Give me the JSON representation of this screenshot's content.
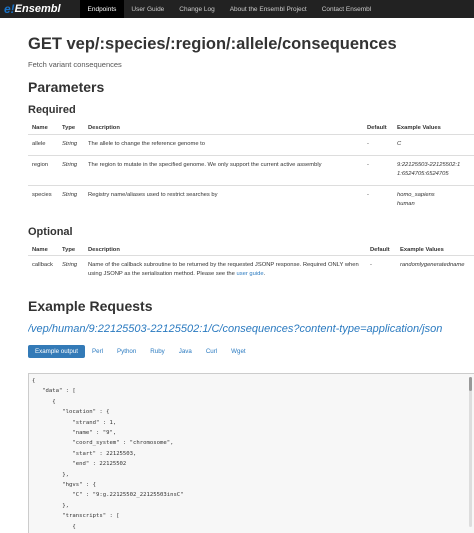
{
  "brand": {
    "e": "e!",
    "name": "Ensembl"
  },
  "nav": [
    "Endpoints",
    "User Guide",
    "Change Log",
    "About the Ensembl Project",
    "Contact Ensembl"
  ],
  "page": {
    "title": "GET vep/:species/:region/:allele/consequences",
    "subtitle": "Fetch variant consequences"
  },
  "parameters_heading": "Parameters",
  "required": {
    "heading": "Required",
    "headers": [
      "Name",
      "Type",
      "Description",
      "Default",
      "Example Values"
    ],
    "rows": [
      {
        "name": "allele",
        "type": "String",
        "desc": "The allele to change the reference genome to",
        "default": "-",
        "ex1": "C",
        "ex2": ""
      },
      {
        "name": "region",
        "type": "String",
        "desc": "The region to mutate in the specified genome. We only support the current active assembly",
        "default": "-",
        "ex1": "9:22125503-22125502:1",
        "ex2": "1:6524705:6524705"
      },
      {
        "name": "species",
        "type": "String",
        "desc": "Registry name/aliases used to restrict searches by",
        "default": "-",
        "ex1": "homo_sapiens",
        "ex2": "human"
      }
    ]
  },
  "optional": {
    "heading": "Optional",
    "headers": [
      "Name",
      "Type",
      "Description",
      "Default",
      "Example Values"
    ],
    "rows": [
      {
        "name": "callback",
        "type": "String",
        "desc": "Name of the callback subroutine to be returned by the requested JSONP response. Required ONLY when using JSONP as the serialisation method. Please see the",
        "link": "user guide",
        "after": ".",
        "default": "-",
        "ex1": "randomlygeneratedname"
      }
    ]
  },
  "example": {
    "heading": "Example Requests",
    "url": "/vep/human/9:22125503-22125502:1/C/consequences?content-type=application/json",
    "tabs": [
      "Example output",
      "Perl",
      "Python",
      "Ruby",
      "Java",
      "Curl",
      "Wget"
    ],
    "code": "{\n   \"data\" : [\n      {\n         \"location\" : {\n            \"strand\" : 1,\n            \"name\" : \"9\",\n            \"coord_system\" : \"chromosome\",\n            \"start\" : 22125503,\n            \"end\" : 22125502\n         },\n         \"hgvs\" : {\n            \"C\" : \"9:g.22125502_22125503insC\"\n         },\n         \"transcripts\" : [\n            {\n               \"cds_start\" : null,\n               \"gene_id\" : \"ENSG00000240498\","
  }
}
